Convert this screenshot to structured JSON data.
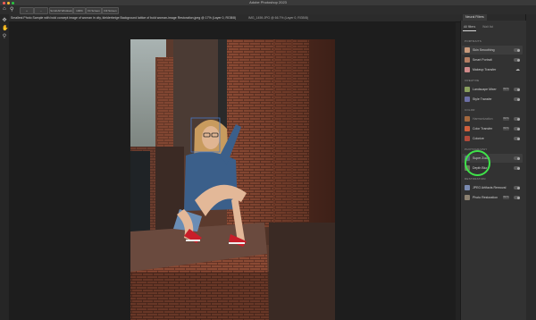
{
  "window": {
    "title": "Adobe Photoshop 2023"
  },
  "options_bar": {
    "buttons": [
      "Scroll All Windows",
      "100%",
      "Fit Screen",
      "Fill Screen"
    ]
  },
  "document": {
    "tab_label": "Smallest Photo Sample with bold concept image of woman in city, kleiderbeige Background lattice of bold woman-image Restoration.jpeg @ 17% (Layer 0, RGB/8)",
    "tab_label_2": "IMG_1459.JPG @ 66.7% (Layer 0, RGB/8)"
  },
  "panel": {
    "header": "Neural Filters",
    "tabs": {
      "all": "All filters",
      "wait": "Wait list"
    },
    "sections": {
      "portraits": "PORTRAITS",
      "creative": "CREATIVE",
      "color": "COLOR",
      "photography": "PHOTOGRAPHY",
      "restoration": "RESTORATION"
    },
    "filters": [
      {
        "label": "Skin Smoothing"
      },
      {
        "label": "Smart Portrait"
      },
      {
        "label": "Makeup Transfer"
      },
      {
        "label": "Landscape Mixer",
        "badge": "BETA"
      },
      {
        "label": "Style Transfer"
      },
      {
        "label": "Harmonization",
        "badge": "BETA"
      },
      {
        "label": "Color Transfer",
        "badge": "BETA"
      },
      {
        "label": "Colorize"
      },
      {
        "label": "Super Zoom"
      },
      {
        "label": "Depth Blur"
      },
      {
        "label": "JPEG Artifacts Removal"
      },
      {
        "label": "Photo Restoration",
        "badge": "BETA"
      }
    ]
  },
  "colors": {
    "highlight_circle": "#3fe24a",
    "panel_bg": "#323232",
    "canvas_bg": "#1d1d1d"
  }
}
